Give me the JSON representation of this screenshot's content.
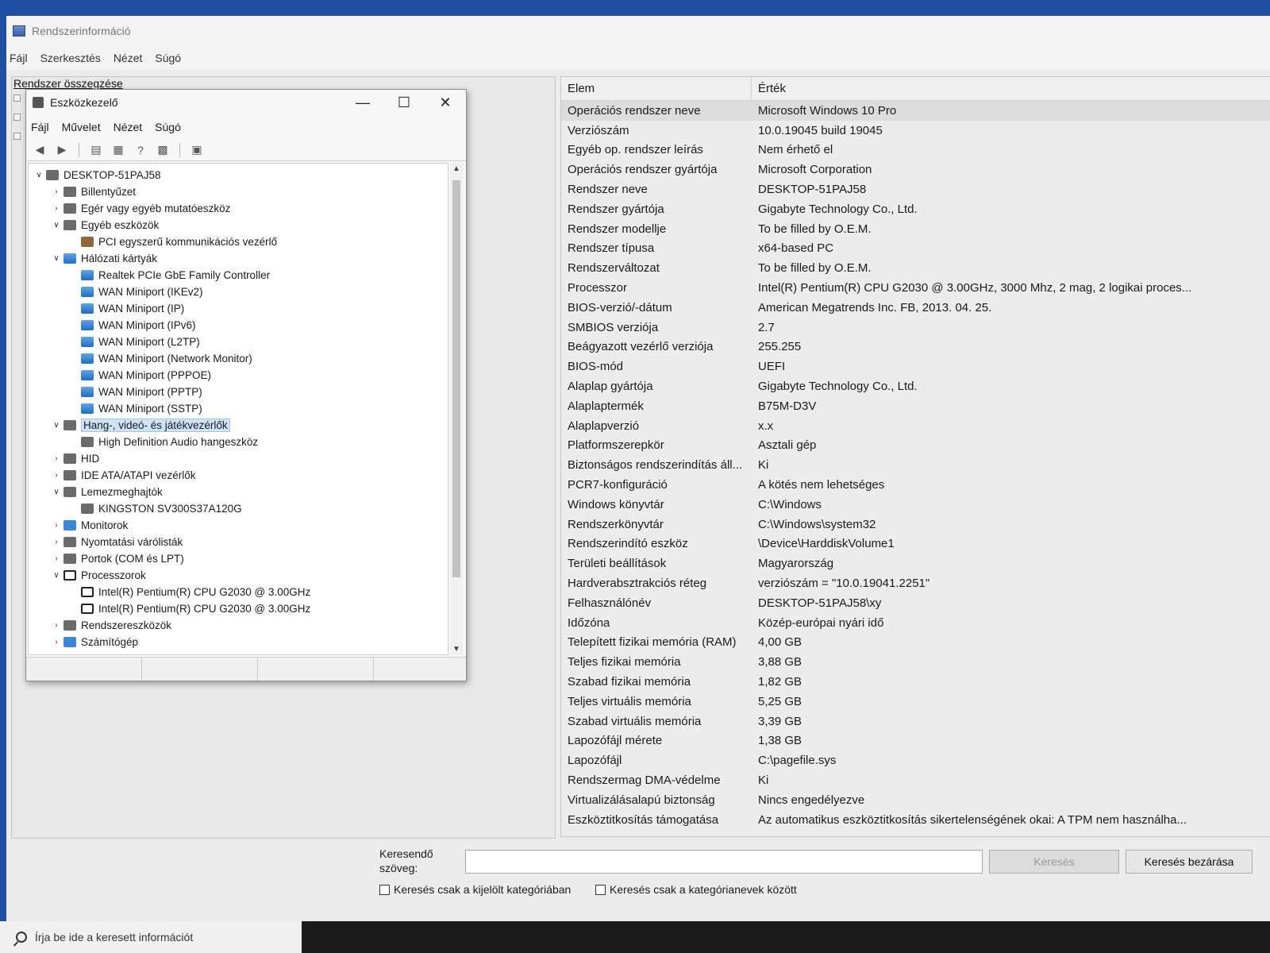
{
  "window": {
    "title": "Rendszerinformáció",
    "menu": [
      "Fájl",
      "Szerkesztés",
      "Nézet",
      "Súgó"
    ]
  },
  "left_pane": {
    "summary_label": "Rendszer összegzése"
  },
  "table": {
    "headers": {
      "item": "Elem",
      "value": "Érték"
    },
    "rows": [
      {
        "item": "Operációs rendszer neve",
        "value": "Microsoft Windows 10 Pro"
      },
      {
        "item": "Verziószám",
        "value": "10.0.19045 build 19045"
      },
      {
        "item": "Egyéb op. rendszer leírás",
        "value": "Nem érhető el"
      },
      {
        "item": "Operációs rendszer gyártója",
        "value": "Microsoft Corporation"
      },
      {
        "item": "Rendszer neve",
        "value": "DESKTOP-51PAJ58"
      },
      {
        "item": "Rendszer gyártója",
        "value": "Gigabyte Technology Co., Ltd."
      },
      {
        "item": "Rendszer modellje",
        "value": "To be filled by O.E.M."
      },
      {
        "item": "Rendszer típusa",
        "value": "x64-based PC"
      },
      {
        "item": "Rendszerváltozat",
        "value": "To be filled by O.E.M."
      },
      {
        "item": "Processzor",
        "value": "Intel(R) Pentium(R) CPU G2030 @ 3.00GHz, 3000 Mhz, 2 mag, 2 logikai proces..."
      },
      {
        "item": "BIOS-verzió/-dátum",
        "value": "American Megatrends Inc. FB, 2013. 04. 25."
      },
      {
        "item": "SMBIOS verziója",
        "value": "2.7"
      },
      {
        "item": "Beágyazott vezérlő verziója",
        "value": "255.255"
      },
      {
        "item": "BIOS-mód",
        "value": "UEFI"
      },
      {
        "item": "Alaplap gyártója",
        "value": "Gigabyte Technology Co., Ltd."
      },
      {
        "item": "Alaplaptermék",
        "value": "B75M-D3V"
      },
      {
        "item": "Alaplapverzió",
        "value": "x.x"
      },
      {
        "item": "Platformszerepkör",
        "value": "Asztali gép"
      },
      {
        "item": "Biztonságos rendszerindítás áll...",
        "value": "Ki"
      },
      {
        "item": "PCR7-konfiguráció",
        "value": "A kötés nem lehetséges"
      },
      {
        "item": "Windows könyvtár",
        "value": "C:\\Windows"
      },
      {
        "item": "Rendszerkönyvtár",
        "value": "C:\\Windows\\system32"
      },
      {
        "item": "Rendszerindító eszköz",
        "value": "\\Device\\HarddiskVolume1"
      },
      {
        "item": "Területi beállítások",
        "value": "Magyarország"
      },
      {
        "item": "Hardverabsztrakciós réteg",
        "value": "verziószám = \"10.0.19041.2251\""
      },
      {
        "item": "Felhasználónév",
        "value": "DESKTOP-51PAJ58\\xy"
      },
      {
        "item": "Időzóna",
        "value": "Közép-európai nyári idő"
      },
      {
        "item": "Telepített fizikai memória (RAM)",
        "value": "4,00 GB"
      },
      {
        "item": "Teljes fizikai memória",
        "value": "3,88 GB"
      },
      {
        "item": "Szabad fizikai memória",
        "value": "1,82 GB"
      },
      {
        "item": "Teljes virtuális memória",
        "value": "5,25 GB"
      },
      {
        "item": "Szabad virtuális memória",
        "value": "3,39 GB"
      },
      {
        "item": "Lapozófájl mérete",
        "value": "1,38 GB"
      },
      {
        "item": "Lapozófájl",
        "value": "C:\\pagefile.sys"
      },
      {
        "item": "Rendszermag DMA-védelme",
        "value": "Ki"
      },
      {
        "item": "Virtualizálásalapú biztonság",
        "value": "Nincs engedélyezve"
      },
      {
        "item": "Eszköztitkosítás támogatása",
        "value": "Az automatikus eszköztitkosítás sikertelenségének okai: A TPM nem használha..."
      }
    ]
  },
  "search": {
    "label": "Keresendő szöveg:",
    "input_value": "",
    "search_button": "Keresés",
    "close_button": "Keresés bezárása",
    "checkbox_selected_category": "Keresés csak a kijelölt kategóriában",
    "checkbox_category_names": "Keresés csak a kategórianevek között"
  },
  "taskbar": {
    "search_placeholder": "Írja be ide a keresett információt"
  },
  "device_manager": {
    "title": "Eszközkezelő",
    "menu": [
      "Fájl",
      "Művelet",
      "Nézet",
      "Súgó"
    ],
    "tree": [
      {
        "label": "DESKTOP-51PAJ58",
        "level": 0,
        "state": "expanded",
        "icon": "computer-icon"
      },
      {
        "label": "Billentyűzet",
        "level": 1,
        "state": "collapsed",
        "icon": "keyboard-icon"
      },
      {
        "label": "Egér vagy egyéb mutatóeszköz",
        "level": 1,
        "state": "collapsed",
        "icon": "mouse-icon"
      },
      {
        "label": "Egyéb eszközök",
        "level": 1,
        "state": "expanded",
        "icon": "unknown-device-icon"
      },
      {
        "label": "PCI egyszerű kommunikációs vezérlő",
        "level": 2,
        "state": "leaf",
        "icon": "warning-device-icon"
      },
      {
        "label": "Hálózati kártyák",
        "level": 1,
        "state": "expanded",
        "icon": "network-adapter-icon"
      },
      {
        "label": "Realtek PCIe GbE Family Controller",
        "level": 2,
        "state": "leaf",
        "icon": "network-adapter-icon"
      },
      {
        "label": "WAN Miniport (IKEv2)",
        "level": 2,
        "state": "leaf",
        "icon": "network-adapter-icon"
      },
      {
        "label": "WAN Miniport (IP)",
        "level": 2,
        "state": "leaf",
        "icon": "network-adapter-icon"
      },
      {
        "label": "WAN Miniport (IPv6)",
        "level": 2,
        "state": "leaf",
        "icon": "network-adapter-icon"
      },
      {
        "label": "WAN Miniport (L2TP)",
        "level": 2,
        "state": "leaf",
        "icon": "network-adapter-icon"
      },
      {
        "label": "WAN Miniport (Network Monitor)",
        "level": 2,
        "state": "leaf",
        "icon": "network-adapter-icon"
      },
      {
        "label": "WAN Miniport (PPPOE)",
        "level": 2,
        "state": "leaf",
        "icon": "network-adapter-icon"
      },
      {
        "label": "WAN Miniport (PPTP)",
        "level": 2,
        "state": "leaf",
        "icon": "network-adapter-icon"
      },
      {
        "label": "WAN Miniport (SSTP)",
        "level": 2,
        "state": "leaf",
        "icon": "network-adapter-icon"
      },
      {
        "label": "Hang-, videó- és játékvezérlők",
        "level": 1,
        "state": "expanded",
        "icon": "speaker-icon",
        "selected": true
      },
      {
        "label": "High Definition Audio hangeszköz",
        "level": 2,
        "state": "leaf",
        "icon": "speaker-icon"
      },
      {
        "label": "HID",
        "level": 1,
        "state": "collapsed",
        "icon": "hid-icon"
      },
      {
        "label": "IDE ATA/ATAPI vezérlők",
        "level": 1,
        "state": "collapsed",
        "icon": "ide-controller-icon"
      },
      {
        "label": "Lemezmeghajtók",
        "level": 1,
        "state": "expanded",
        "icon": "disk-drive-icon"
      },
      {
        "label": "KINGSTON SV300S37A120G",
        "level": 2,
        "state": "leaf",
        "icon": "disk-drive-icon"
      },
      {
        "label": "Monitorok",
        "level": 1,
        "state": "collapsed",
        "icon": "monitor-icon"
      },
      {
        "label": "Nyomtatási várólisták",
        "level": 1,
        "state": "collapsed",
        "icon": "printer-icon"
      },
      {
        "label": "Portok (COM és LPT)",
        "level": 1,
        "state": "collapsed",
        "icon": "port-icon"
      },
      {
        "label": "Processzorok",
        "level": 1,
        "state": "expanded",
        "icon": "cpu-icon"
      },
      {
        "label": "Intel(R) Pentium(R) CPU G2030 @ 3.00GHz",
        "level": 2,
        "state": "leaf",
        "icon": "cpu-icon"
      },
      {
        "label": "Intel(R) Pentium(R) CPU G2030 @ 3.00GHz",
        "level": 2,
        "state": "leaf",
        "icon": "cpu-icon"
      },
      {
        "label": "Rendszereszközök",
        "level": 1,
        "state": "collapsed",
        "icon": "system-devices-icon"
      },
      {
        "label": "Számítógép",
        "level": 1,
        "state": "collapsed",
        "icon": "monitor-icon"
      }
    ]
  }
}
